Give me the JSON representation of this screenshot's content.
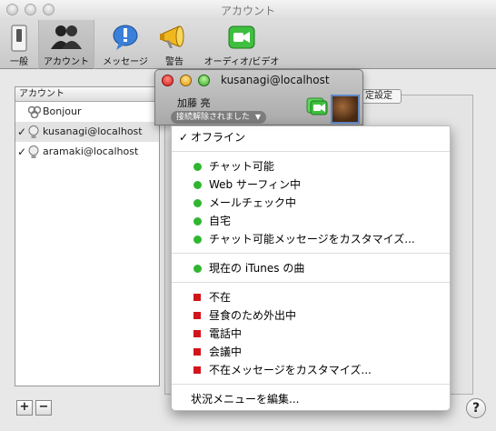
{
  "window": {
    "title": "アカウント"
  },
  "toolbar": {
    "items": [
      {
        "label": "一般",
        "icon": "switch-icon"
      },
      {
        "label": "アカウント",
        "icon": "users-icon"
      },
      {
        "label": "メッセージ",
        "icon": "speech-bubble-icon"
      },
      {
        "label": "警告",
        "icon": "megaphone-icon"
      },
      {
        "label": "オーディオ/ビデオ",
        "icon": "video-camera-icon"
      }
    ]
  },
  "accounts": {
    "header": "アカウント",
    "rows": [
      {
        "checked": "",
        "name": "Bonjour"
      },
      {
        "checked": "✓",
        "name": "kusanagi@localhost"
      },
      {
        "checked": "✓",
        "name": "aramaki@localhost"
      }
    ]
  },
  "settings_tab": "定設定",
  "buddy": {
    "title": "kusanagi@localhost",
    "name": "加藤 亮",
    "status": "接続解除されました"
  },
  "menu": {
    "offline": {
      "check": "✓",
      "label": "オフライン"
    },
    "available": [
      "チャット可能",
      "Web サーフィン中",
      "メールチェック中",
      "自宅",
      "チャット可能メッセージをカスタマイズ..."
    ],
    "itunes": "現在の iTunes の曲",
    "away": [
      "不在",
      "昼食のため外出中",
      "電話中",
      "会議中",
      "不在メッセージをカスタマイズ..."
    ],
    "edit": "状況メニューを編集..."
  },
  "buttons": {
    "add": "+",
    "remove": "−",
    "help": "?"
  },
  "colors": {
    "available": "#2fb62f",
    "away": "#d3141c",
    "selection": "#5e88c8"
  }
}
